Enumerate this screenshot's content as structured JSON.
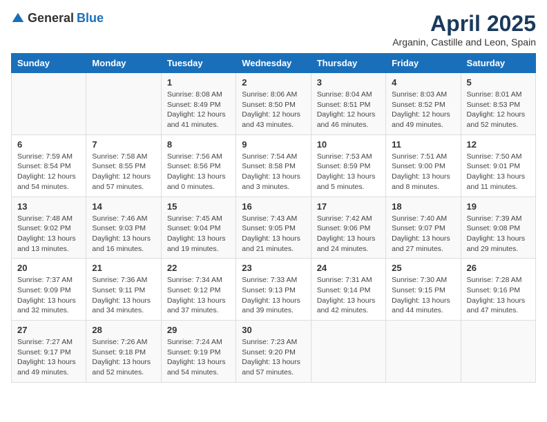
{
  "logo": {
    "general": "General",
    "blue": "Blue"
  },
  "header": {
    "title": "April 2025",
    "subtitle": "Arganin, Castille and Leon, Spain"
  },
  "weekdays": [
    "Sunday",
    "Monday",
    "Tuesday",
    "Wednesday",
    "Thursday",
    "Friday",
    "Saturday"
  ],
  "weeks": [
    [
      {
        "day": "",
        "sunrise": "",
        "sunset": "",
        "daylight": ""
      },
      {
        "day": "",
        "sunrise": "",
        "sunset": "",
        "daylight": ""
      },
      {
        "day": "1",
        "sunrise": "Sunrise: 8:08 AM",
        "sunset": "Sunset: 8:49 PM",
        "daylight": "Daylight: 12 hours and 41 minutes."
      },
      {
        "day": "2",
        "sunrise": "Sunrise: 8:06 AM",
        "sunset": "Sunset: 8:50 PM",
        "daylight": "Daylight: 12 hours and 43 minutes."
      },
      {
        "day": "3",
        "sunrise": "Sunrise: 8:04 AM",
        "sunset": "Sunset: 8:51 PM",
        "daylight": "Daylight: 12 hours and 46 minutes."
      },
      {
        "day": "4",
        "sunrise": "Sunrise: 8:03 AM",
        "sunset": "Sunset: 8:52 PM",
        "daylight": "Daylight: 12 hours and 49 minutes."
      },
      {
        "day": "5",
        "sunrise": "Sunrise: 8:01 AM",
        "sunset": "Sunset: 8:53 PM",
        "daylight": "Daylight: 12 hours and 52 minutes."
      }
    ],
    [
      {
        "day": "6",
        "sunrise": "Sunrise: 7:59 AM",
        "sunset": "Sunset: 8:54 PM",
        "daylight": "Daylight: 12 hours and 54 minutes."
      },
      {
        "day": "7",
        "sunrise": "Sunrise: 7:58 AM",
        "sunset": "Sunset: 8:55 PM",
        "daylight": "Daylight: 12 hours and 57 minutes."
      },
      {
        "day": "8",
        "sunrise": "Sunrise: 7:56 AM",
        "sunset": "Sunset: 8:56 PM",
        "daylight": "Daylight: 13 hours and 0 minutes."
      },
      {
        "day": "9",
        "sunrise": "Sunrise: 7:54 AM",
        "sunset": "Sunset: 8:58 PM",
        "daylight": "Daylight: 13 hours and 3 minutes."
      },
      {
        "day": "10",
        "sunrise": "Sunrise: 7:53 AM",
        "sunset": "Sunset: 8:59 PM",
        "daylight": "Daylight: 13 hours and 5 minutes."
      },
      {
        "day": "11",
        "sunrise": "Sunrise: 7:51 AM",
        "sunset": "Sunset: 9:00 PM",
        "daylight": "Daylight: 13 hours and 8 minutes."
      },
      {
        "day": "12",
        "sunrise": "Sunrise: 7:50 AM",
        "sunset": "Sunset: 9:01 PM",
        "daylight": "Daylight: 13 hours and 11 minutes."
      }
    ],
    [
      {
        "day": "13",
        "sunrise": "Sunrise: 7:48 AM",
        "sunset": "Sunset: 9:02 PM",
        "daylight": "Daylight: 13 hours and 13 minutes."
      },
      {
        "day": "14",
        "sunrise": "Sunrise: 7:46 AM",
        "sunset": "Sunset: 9:03 PM",
        "daylight": "Daylight: 13 hours and 16 minutes."
      },
      {
        "day": "15",
        "sunrise": "Sunrise: 7:45 AM",
        "sunset": "Sunset: 9:04 PM",
        "daylight": "Daylight: 13 hours and 19 minutes."
      },
      {
        "day": "16",
        "sunrise": "Sunrise: 7:43 AM",
        "sunset": "Sunset: 9:05 PM",
        "daylight": "Daylight: 13 hours and 21 minutes."
      },
      {
        "day": "17",
        "sunrise": "Sunrise: 7:42 AM",
        "sunset": "Sunset: 9:06 PM",
        "daylight": "Daylight: 13 hours and 24 minutes."
      },
      {
        "day": "18",
        "sunrise": "Sunrise: 7:40 AM",
        "sunset": "Sunset: 9:07 PM",
        "daylight": "Daylight: 13 hours and 27 minutes."
      },
      {
        "day": "19",
        "sunrise": "Sunrise: 7:39 AM",
        "sunset": "Sunset: 9:08 PM",
        "daylight": "Daylight: 13 hours and 29 minutes."
      }
    ],
    [
      {
        "day": "20",
        "sunrise": "Sunrise: 7:37 AM",
        "sunset": "Sunset: 9:09 PM",
        "daylight": "Daylight: 13 hours and 32 minutes."
      },
      {
        "day": "21",
        "sunrise": "Sunrise: 7:36 AM",
        "sunset": "Sunset: 9:11 PM",
        "daylight": "Daylight: 13 hours and 34 minutes."
      },
      {
        "day": "22",
        "sunrise": "Sunrise: 7:34 AM",
        "sunset": "Sunset: 9:12 PM",
        "daylight": "Daylight: 13 hours and 37 minutes."
      },
      {
        "day": "23",
        "sunrise": "Sunrise: 7:33 AM",
        "sunset": "Sunset: 9:13 PM",
        "daylight": "Daylight: 13 hours and 39 minutes."
      },
      {
        "day": "24",
        "sunrise": "Sunrise: 7:31 AM",
        "sunset": "Sunset: 9:14 PM",
        "daylight": "Daylight: 13 hours and 42 minutes."
      },
      {
        "day": "25",
        "sunrise": "Sunrise: 7:30 AM",
        "sunset": "Sunset: 9:15 PM",
        "daylight": "Daylight: 13 hours and 44 minutes."
      },
      {
        "day": "26",
        "sunrise": "Sunrise: 7:28 AM",
        "sunset": "Sunset: 9:16 PM",
        "daylight": "Daylight: 13 hours and 47 minutes."
      }
    ],
    [
      {
        "day": "27",
        "sunrise": "Sunrise: 7:27 AM",
        "sunset": "Sunset: 9:17 PM",
        "daylight": "Daylight: 13 hours and 49 minutes."
      },
      {
        "day": "28",
        "sunrise": "Sunrise: 7:26 AM",
        "sunset": "Sunset: 9:18 PM",
        "daylight": "Daylight: 13 hours and 52 minutes."
      },
      {
        "day": "29",
        "sunrise": "Sunrise: 7:24 AM",
        "sunset": "Sunset: 9:19 PM",
        "daylight": "Daylight: 13 hours and 54 minutes."
      },
      {
        "day": "30",
        "sunrise": "Sunrise: 7:23 AM",
        "sunset": "Sunset: 9:20 PM",
        "daylight": "Daylight: 13 hours and 57 minutes."
      },
      {
        "day": "",
        "sunrise": "",
        "sunset": "",
        "daylight": ""
      },
      {
        "day": "",
        "sunrise": "",
        "sunset": "",
        "daylight": ""
      },
      {
        "day": "",
        "sunrise": "",
        "sunset": "",
        "daylight": ""
      }
    ]
  ]
}
